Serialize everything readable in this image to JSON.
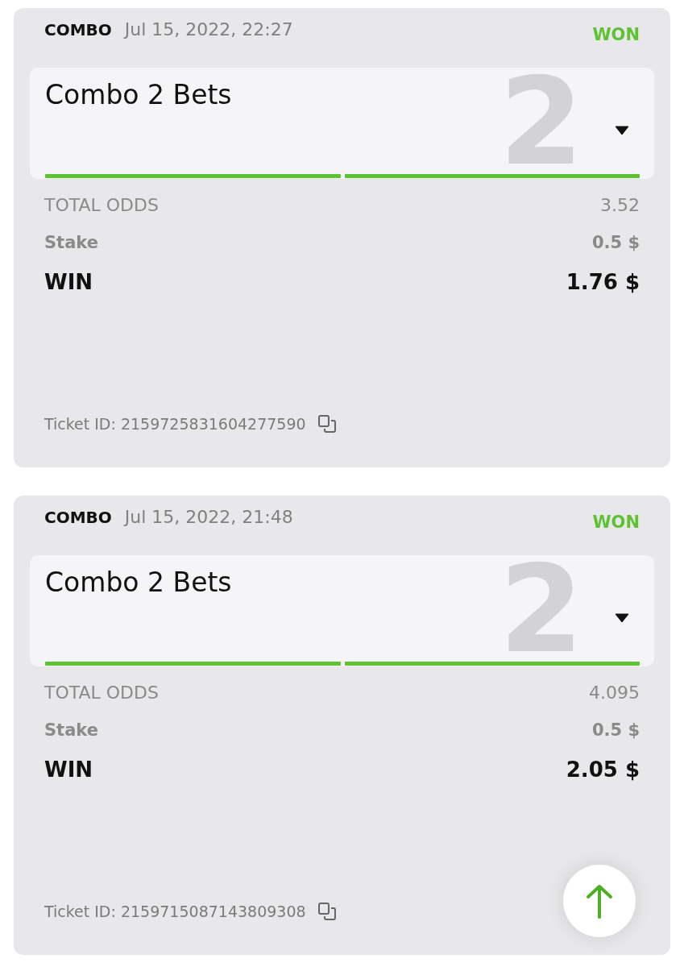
{
  "tickets": [
    {
      "type": "COMBO",
      "date": "Jul 15, 2022, 22:27",
      "status": "WON",
      "won": true,
      "bet": {
        "title": "Combo 2 Bets",
        "count": "2",
        "legs": [
          {
            "won": true
          },
          {
            "won": true
          }
        ]
      },
      "total_odds_label": "TOTAL ODDS",
      "total_odds": "3.52",
      "stake_label": "Stake",
      "stake": "0.5 $",
      "win_label": "WIN",
      "win": "1.76 $",
      "ticket_id": "Ticket ID: 2159725831604277590"
    },
    {
      "type": "COMBO",
      "date": "Jul 15, 2022, 21:48",
      "status": "WON",
      "won": true,
      "bet": {
        "title": "Combo 2 Bets",
        "count": "2",
        "legs": [
          {
            "won": true
          },
          {
            "won": true
          }
        ]
      },
      "total_odds_label": "TOTAL ODDS",
      "total_odds": "4.095",
      "stake_label": "Stake",
      "stake": "0.5 $",
      "win_label": "WIN",
      "win": "2.05 $",
      "ticket_id": "Ticket ID: 2159715087143809308"
    }
  ]
}
